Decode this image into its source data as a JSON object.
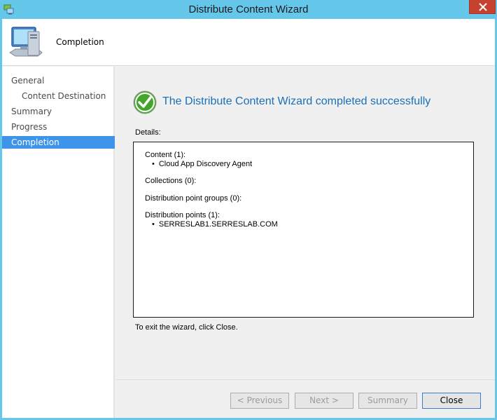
{
  "window": {
    "title": "Distribute Content Wizard"
  },
  "header": {
    "title": "Completion"
  },
  "nav": {
    "items": [
      {
        "label": "General",
        "indent": false,
        "selected": false
      },
      {
        "label": "Content Destination",
        "indent": true,
        "selected": false
      },
      {
        "label": "Summary",
        "indent": false,
        "selected": false
      },
      {
        "label": "Progress",
        "indent": false,
        "selected": false
      },
      {
        "label": "Completion",
        "indent": false,
        "selected": true
      }
    ]
  },
  "main": {
    "success_message": "The Distribute Content Wizard completed successfully",
    "details_label": "Details:",
    "details": {
      "content_heading": "Content (1):",
      "content_item": "Cloud App Discovery Agent",
      "collections_heading": "Collections (0):",
      "dp_groups_heading": "Distribution point groups (0):",
      "dp_heading": "Distribution points (1):",
      "dp_item": "SERRESLAB1.SERRESLAB.COM"
    },
    "exit_text": "To exit the wizard, click Close."
  },
  "buttons": {
    "previous": "< Previous",
    "next": "Next >",
    "summary": "Summary",
    "close": "Close"
  },
  "colors": {
    "titlebar": "#65c7ea",
    "selection": "#3d94e8",
    "success_text": "#1a6fb8",
    "close_button": "#c7412f"
  }
}
